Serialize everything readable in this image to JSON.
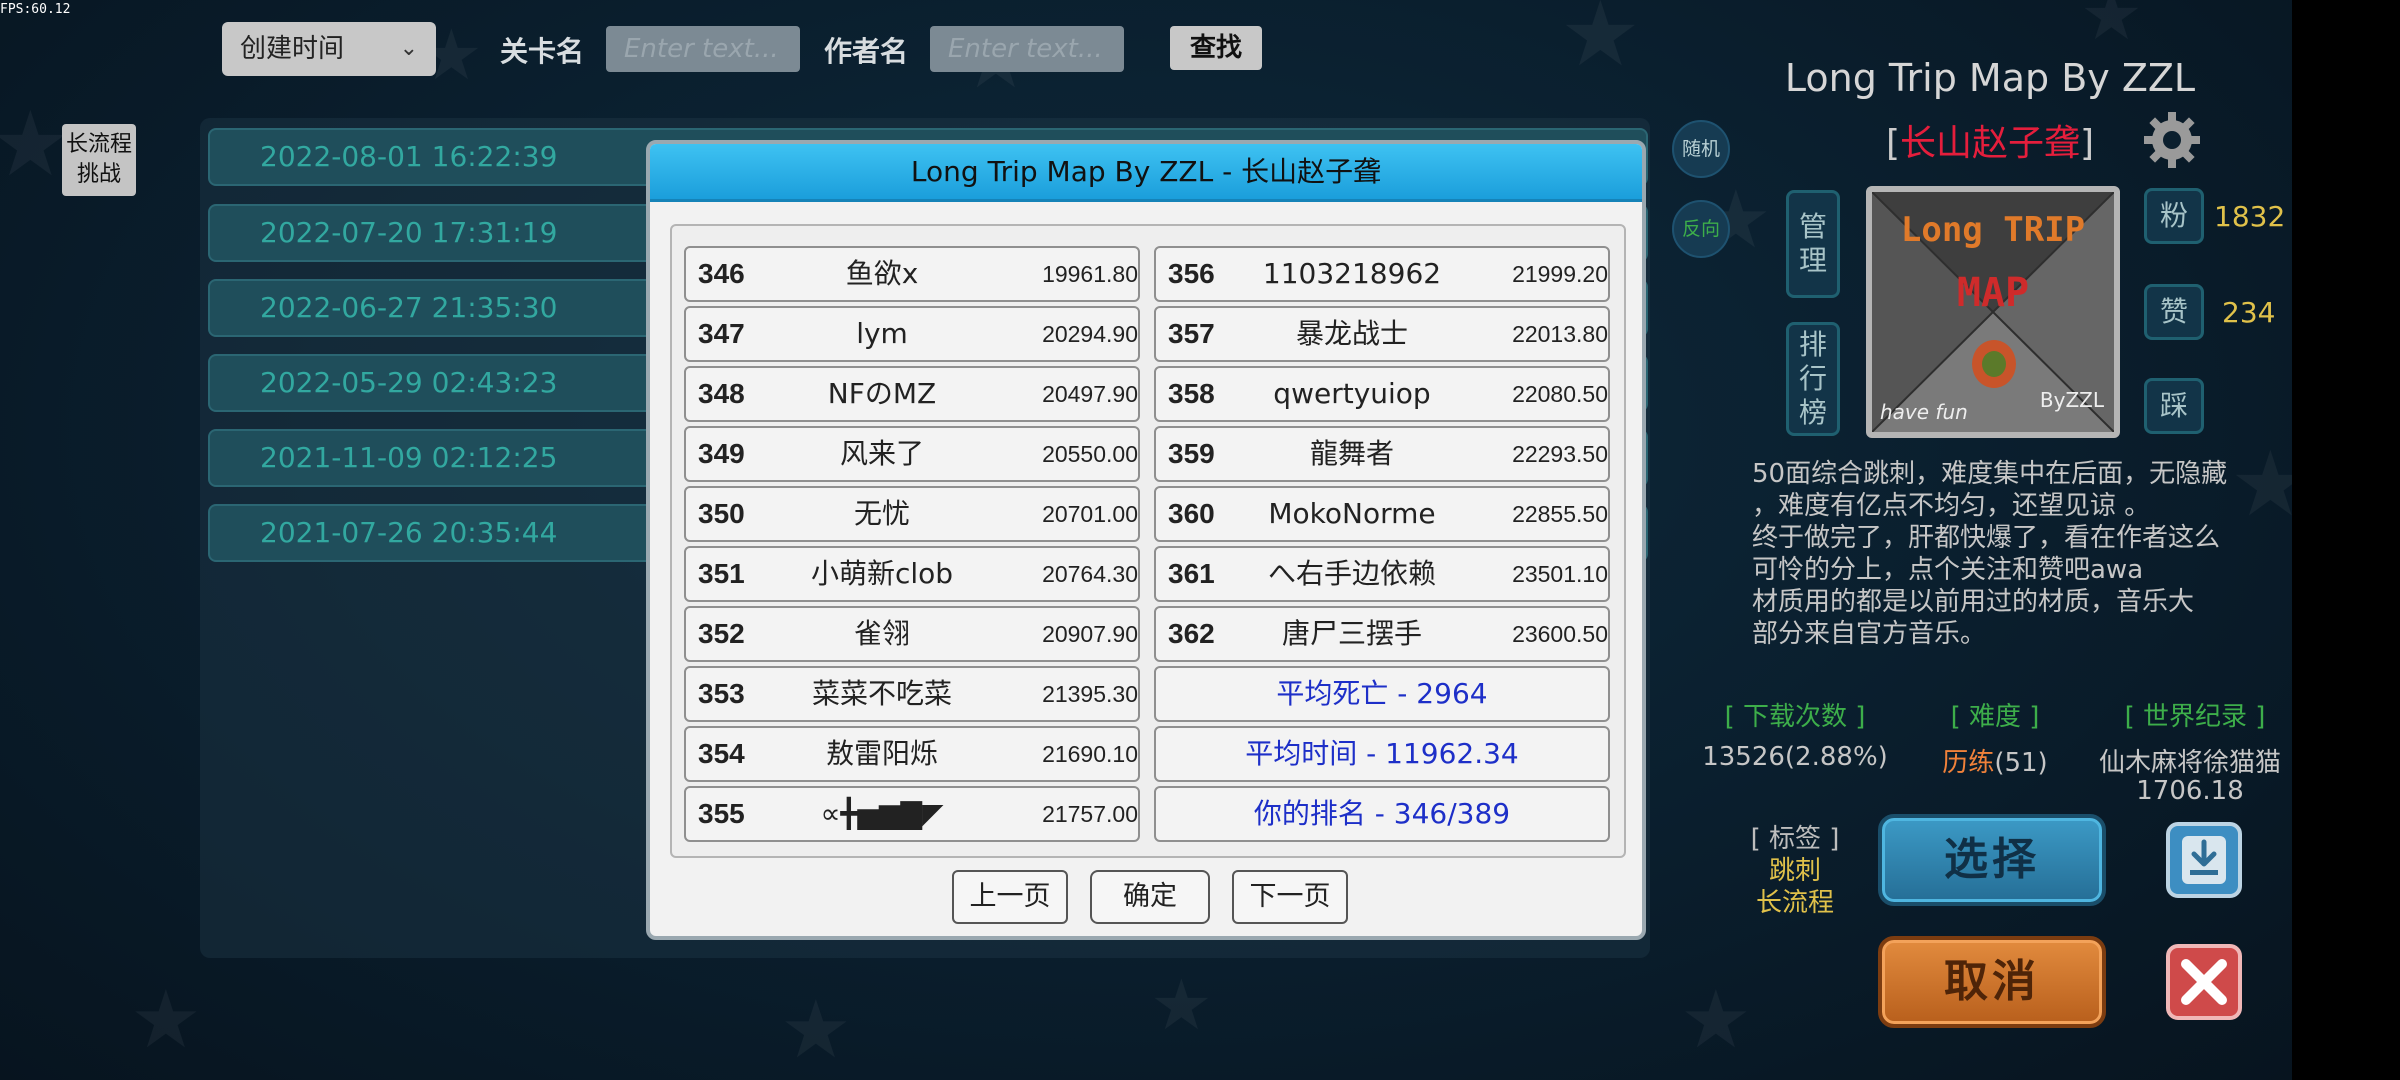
{
  "fps": "FPS:60.12",
  "filter": {
    "sort_value": "创建时间",
    "level_name_label": "关卡名",
    "level_name_placeholder": "Enter text...",
    "author_label": "作者名",
    "author_placeholder": "Enter text...",
    "search_label": "查找"
  },
  "side_tab": {
    "line1": "长流程",
    "line2": "挑战"
  },
  "list": {
    "rows": [
      "2022-08-01 16:22:39",
      "2022-07-20 17:31:19",
      "2022-06-27 21:35:30",
      "2022-05-29 02:43:23",
      "2021-11-09 02:12:25",
      "2021-07-26 20:35:44"
    ]
  },
  "side_buttons": {
    "random": "随机",
    "reverse": "反向"
  },
  "map": {
    "title": "Long Trip Map By ZZL",
    "author": "长山赵子聋",
    "manage_label": "管理",
    "rank_label": "排行榜",
    "thumbnail": {
      "line1": "Long TRIP",
      "line2": "MAP",
      "bottom_left": "have fun",
      "bottom_right": "ByZZL"
    },
    "fans_label": "粉",
    "fans": "1832",
    "likes_label": "赞",
    "likes": "234",
    "dislike_label": "踩",
    "description": [
      "50面综合跳刺，难度集中在后面，无隐藏",
      "，难度有亿点不均匀，还望见谅 。",
      "终于做完了，肝都快爆了，看在作者这么",
      "可怜的分上，点个关注和赞吧awa",
      "材质用的都是以前用过的材质，音乐大",
      "部分来自官方音乐。"
    ],
    "downloads_header": "[ 下载次数 ]",
    "downloads": "13526(2.88%)",
    "difficulty_header": "[ 难度 ]",
    "difficulty_word": "历练",
    "difficulty_value": "(51)",
    "record_header": "[ 世界纪录 ]",
    "record_holder": "仙木麻将徐猫猫",
    "record_time": "1706.18",
    "tags_header": "[ 标签 ]",
    "tags": [
      "跳刺",
      "长流程"
    ],
    "select_label": "选择",
    "cancel_label": "取消"
  },
  "leaderboard": {
    "title": "Long Trip Map By ZZL - 长山赵子聋",
    "left": [
      {
        "rank": "346",
        "name": "鱼欲x",
        "time": "19961.80"
      },
      {
        "rank": "347",
        "name": "lym",
        "time": "20294.90"
      },
      {
        "rank": "348",
        "name": "NFのMZ",
        "time": "20497.90"
      },
      {
        "rank": "349",
        "name": "风来了",
        "time": "20550.00"
      },
      {
        "rank": "350",
        "name": "无忧",
        "time": "20701.00"
      },
      {
        "rank": "351",
        "name": "小萌新clob",
        "time": "20764.30"
      },
      {
        "rank": "352",
        "name": "雀翎",
        "time": "20907.90"
      },
      {
        "rank": "353",
        "name": "菜菜不吃菜",
        "time": "21395.30"
      },
      {
        "rank": "354",
        "name": "敖雷阳烁",
        "time": "21690.10"
      },
      {
        "rank": "355",
        "name": "∝╋▅▆▇◤",
        "time": "21757.00"
      }
    ],
    "right": [
      {
        "rank": "356",
        "name": "1103218962",
        "time": "21999.20"
      },
      {
        "rank": "357",
        "name": "暴龙战士",
        "time": "22013.80"
      },
      {
        "rank": "358",
        "name": "qwertyuiop",
        "time": "22080.50"
      },
      {
        "rank": "359",
        "name": "龍舞者",
        "time": "22293.50"
      },
      {
        "rank": "360",
        "name": "MokoNorme",
        "time": "22855.50"
      },
      {
        "rank": "361",
        "name": "へ右手边依赖",
        "time": "23501.10"
      },
      {
        "rank": "362",
        "name": "唐尸三摆手",
        "time": "23600.50"
      }
    ],
    "avg_deaths": "平均死亡 - 2964",
    "avg_time": "平均时间 - 11962.34",
    "your_rank": "你的排名 - 346/389",
    "prev_label": "上一页",
    "ok_label": "确定",
    "next_label": "下一页"
  },
  "colors": {
    "accent_teal": "#32a8a0",
    "header_blue": "#1b9edb",
    "author_red": "#e51e3c",
    "summary_blue": "#1d2fc8",
    "tag_yellow": "#e0c14a",
    "difficulty_orange": "#f0813a"
  }
}
